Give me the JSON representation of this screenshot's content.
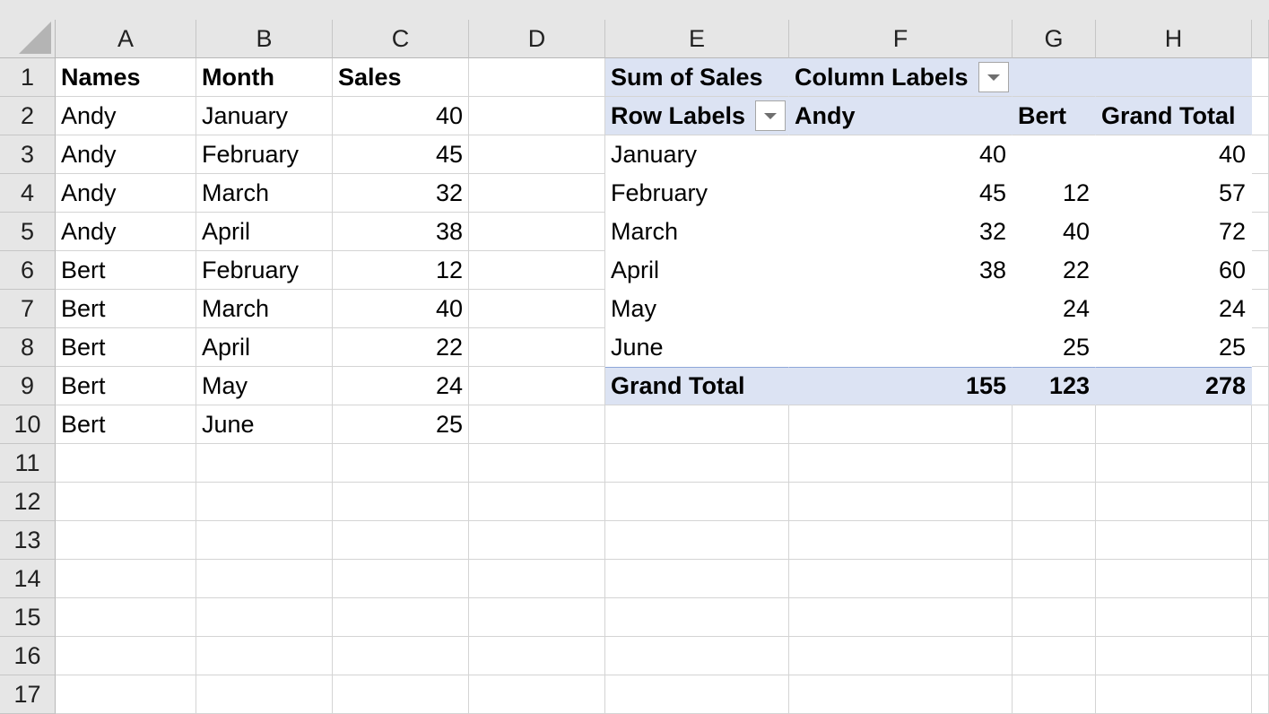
{
  "columns": [
    "A",
    "B",
    "C",
    "D",
    "E",
    "F",
    "G",
    "H"
  ],
  "row_numbers": [
    "1",
    "2",
    "3",
    "4",
    "5",
    "6",
    "7",
    "8",
    "9",
    "10",
    "11",
    "12",
    "13",
    "14",
    "15",
    "16",
    "17"
  ],
  "source": {
    "headers": [
      "Names",
      "Month",
      "Sales"
    ],
    "rows": [
      [
        "Andy",
        "January",
        "40"
      ],
      [
        "Andy",
        "February",
        "45"
      ],
      [
        "Andy",
        "March",
        "32"
      ],
      [
        "Andy",
        "April",
        "38"
      ],
      [
        "Bert",
        "February",
        "12"
      ],
      [
        "Bert",
        "March",
        "40"
      ],
      [
        "Bert",
        "April",
        "22"
      ],
      [
        "Bert",
        "May",
        "24"
      ],
      [
        "Bert",
        "June",
        "25"
      ]
    ]
  },
  "pivot": {
    "values_label": "Sum of Sales",
    "column_labels": "Column Labels",
    "row_labels": "Row Labels",
    "column_headers": [
      "Andy",
      "Bert",
      "Grand Total"
    ],
    "rows": [
      [
        "January",
        "40",
        "",
        "40"
      ],
      [
        "February",
        "45",
        "12",
        "57"
      ],
      [
        "March",
        "32",
        "40",
        "72"
      ],
      [
        "April",
        "38",
        "22",
        "60"
      ],
      [
        "May",
        "",
        "24",
        "24"
      ],
      [
        "June",
        "",
        "25",
        "25"
      ]
    ],
    "grand_total": [
      "Grand Total",
      "155",
      "123",
      "278"
    ]
  },
  "colors": {
    "pivot_fill": "#dce3f3",
    "pivot_border": "#8ea6d9",
    "header_fill": "#e6e6e6",
    "gridline": "#d4d4d4"
  }
}
